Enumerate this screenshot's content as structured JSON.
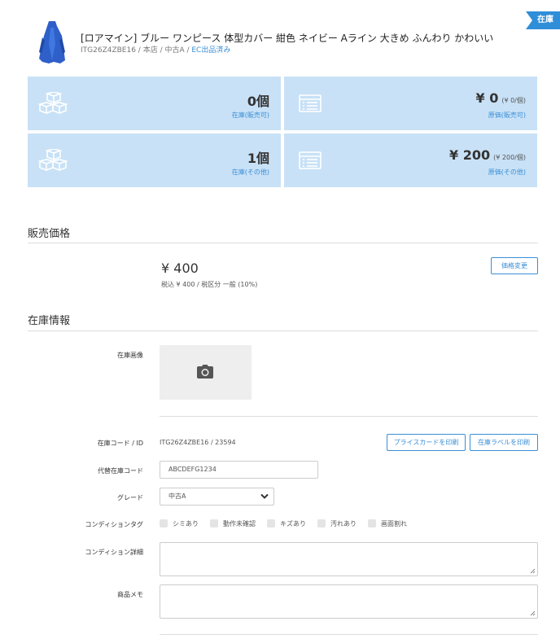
{
  "badge": "在庫",
  "product": {
    "title": "[ロアマイン] ブルー ワンピース 体型カバー 紺色 ネイビー Aライン 大きめ ふんわり かわいい",
    "meta": "ITG26Z4ZBE16 / 本店 / 中古A / ",
    "ec_status": "EC出品済み"
  },
  "stats": [
    {
      "value": "0個",
      "sub": "",
      "label": "在庫(販売可)",
      "icon": "cubes-icon"
    },
    {
      "value": "¥ 0",
      "sub": "(¥ 0/個)",
      "label": "原価(販売可)",
      "icon": "list-icon"
    },
    {
      "value": "1個",
      "sub": "",
      "label": "在庫(その他)",
      "icon": "cubes-icon"
    },
    {
      "value": "¥ 200",
      "sub": "(¥ 200/個)",
      "label": "原価(その他)",
      "icon": "list-icon"
    }
  ],
  "pricing": {
    "section_title": "販売価格",
    "price": "¥ 400",
    "tax_note": "税込 ¥ 400 / 税区分 一般 (10%)",
    "change_button": "価格変更"
  },
  "stock_info": {
    "section_title": "在庫情報",
    "image_label": "在庫画像",
    "code_label": "在庫コード / ID",
    "code_value": "ITG26Z4ZBE16 / 23594",
    "price_card_button": "プライスカードを印刷",
    "stock_label_button": "在庫ラベルを印刷",
    "alt_code_label": "代替在庫コード",
    "alt_code_value": "ABCDEFG1234",
    "grade_label": "グレード",
    "grade_value": "中古A",
    "condition_tags_label": "コンディションタグ",
    "condition_tags": [
      "シミあり",
      "動作未確認",
      "キズあり",
      "汚れあり",
      "画面割れ"
    ],
    "condition_detail_label": "コンディション詳細",
    "memo_label": "商品メモ"
  },
  "colors": {
    "accent": "#3a8ed6",
    "card_bg": "#c8e1f6",
    "card_icon": "#ffffff"
  }
}
